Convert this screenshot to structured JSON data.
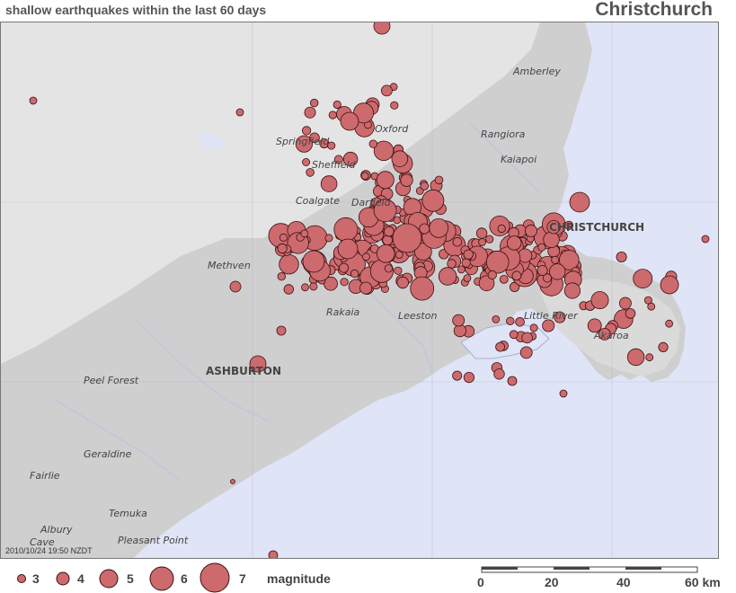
{
  "header": {
    "subtitle": "shallow earthquakes within the last 60 days",
    "title": "Christchurch"
  },
  "timestamp": "2010/10/24 19:50 NZDT",
  "colors": {
    "ocean": "#dfe4f6",
    "land": "#cfcfcf",
    "mountains": "#e4e4e4",
    "quake_fill": "#cd6a6e",
    "quake_stroke": "#3a1010"
  },
  "places": [
    {
      "name": "Amberley",
      "kind": "town"
    },
    {
      "name": "Oxford",
      "kind": "town"
    },
    {
      "name": "Rangiora",
      "kind": "town"
    },
    {
      "name": "Springfield",
      "kind": "town"
    },
    {
      "name": "Sheffield",
      "kind": "town"
    },
    {
      "name": "Kaiapoi",
      "kind": "town"
    },
    {
      "name": "Coalgate",
      "kind": "town"
    },
    {
      "name": "Darfield",
      "kind": "town"
    },
    {
      "name": "CHRISTCHURCH",
      "kind": "city"
    },
    {
      "name": "Methven",
      "kind": "town"
    },
    {
      "name": "Rakaia",
      "kind": "town"
    },
    {
      "name": "Leeston",
      "kind": "town"
    },
    {
      "name": "Little River",
      "kind": "town"
    },
    {
      "name": "Akaroa",
      "kind": "town"
    },
    {
      "name": "ASHBURTON",
      "kind": "city"
    },
    {
      "name": "Peel Forest",
      "kind": "town"
    },
    {
      "name": "Geraldine",
      "kind": "town"
    },
    {
      "name": "Fairlie",
      "kind": "town"
    },
    {
      "name": "Temuka",
      "kind": "town"
    },
    {
      "name": "Albury",
      "kind": "town"
    },
    {
      "name": "Cave",
      "kind": "town"
    },
    {
      "name": "Pleasant Point",
      "kind": "town"
    }
  ],
  "legend": {
    "magnitudes": [
      "3",
      "4",
      "5",
      "6",
      "7"
    ],
    "label": "magnitude"
  },
  "scale": {
    "ticks": [
      "0",
      "20",
      "40",
      "60 km"
    ]
  }
}
